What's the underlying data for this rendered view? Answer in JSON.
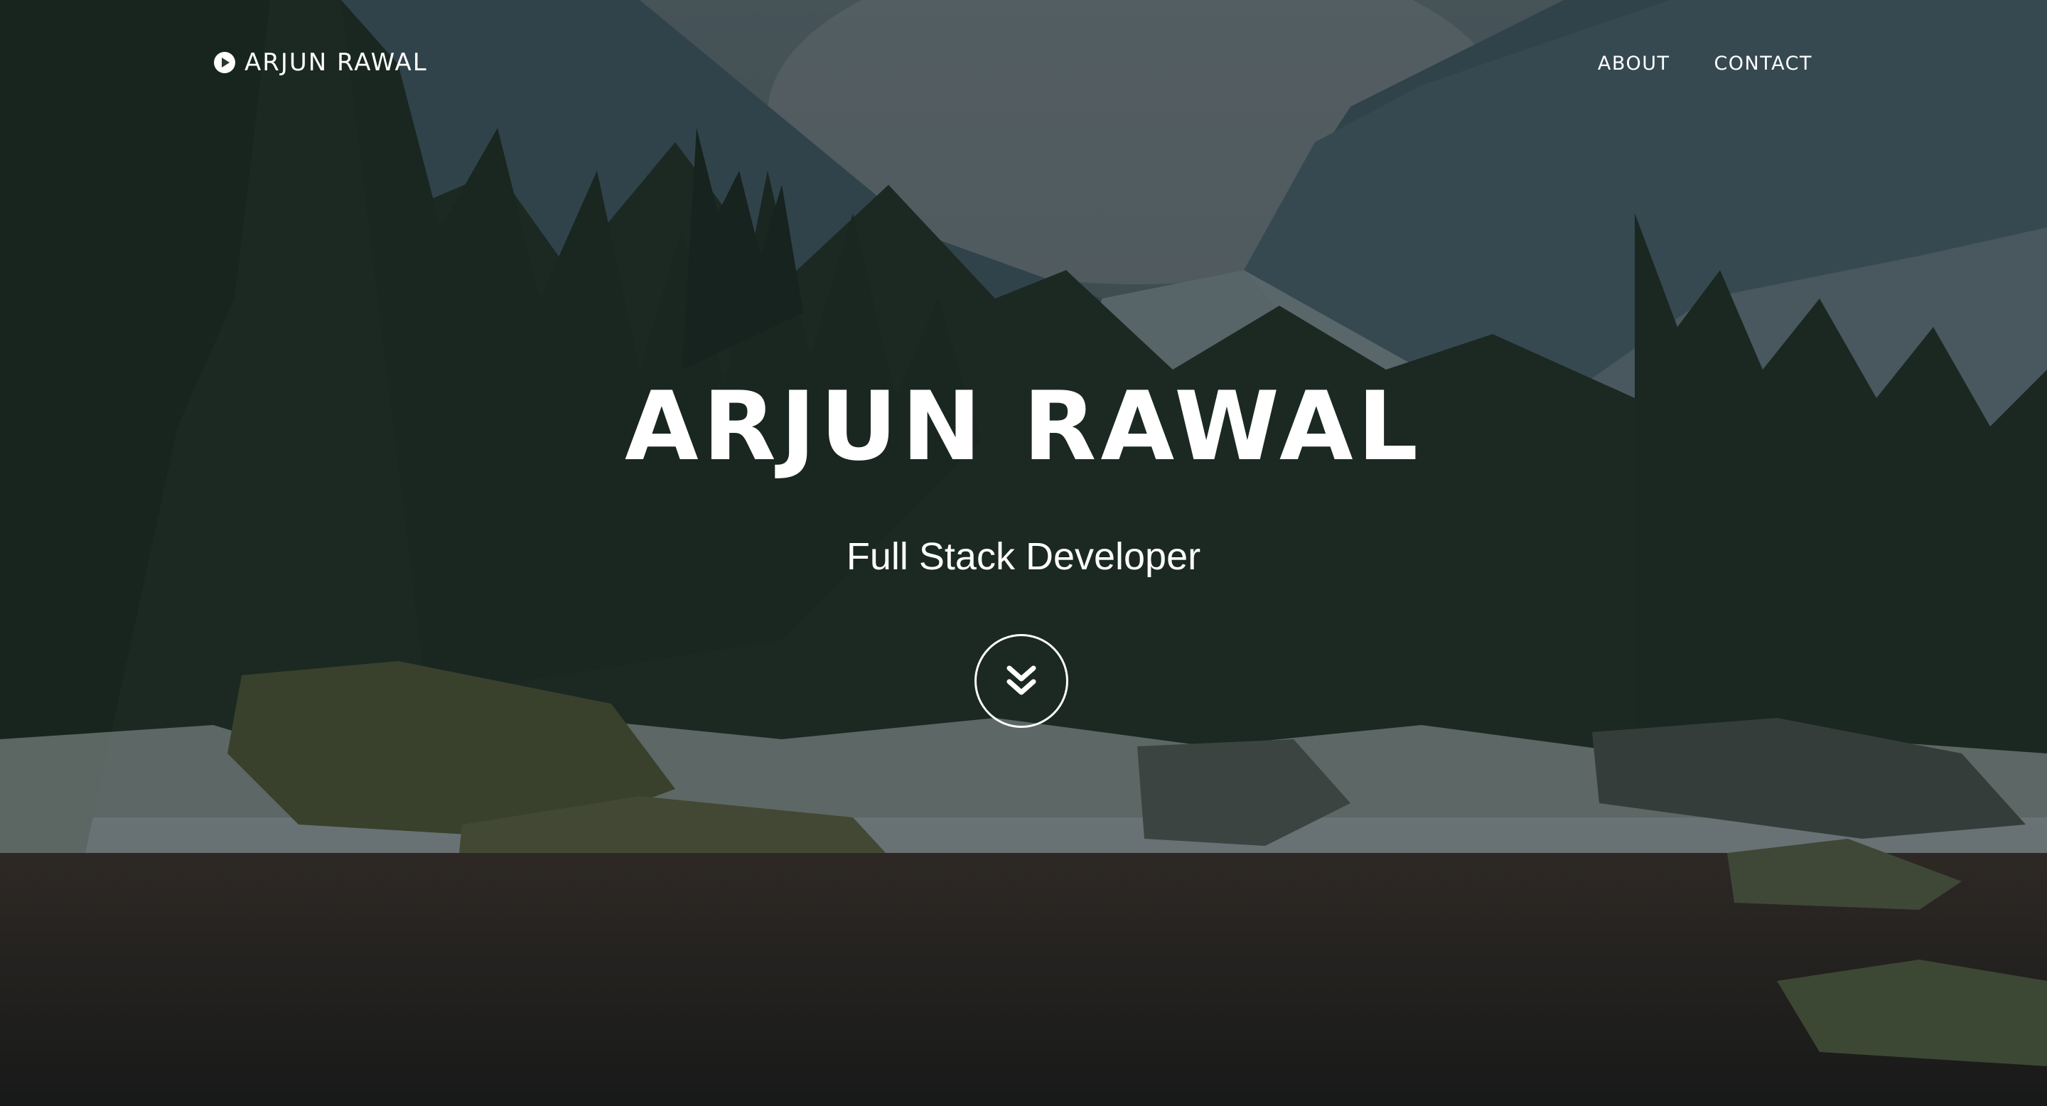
{
  "nav": {
    "brand": "ARJUN RAWAL",
    "brand_icon": "play-circle-icon",
    "links": [
      {
        "label": "ABOUT"
      },
      {
        "label": "CONTACT"
      }
    ]
  },
  "hero": {
    "title": "ARJUN RAWAL",
    "subtitle": "Full Stack Developer",
    "scroll_icon": "double-chevron-down-icon"
  },
  "colors": {
    "text": "#ffffff",
    "overlay": "#1b2424"
  }
}
